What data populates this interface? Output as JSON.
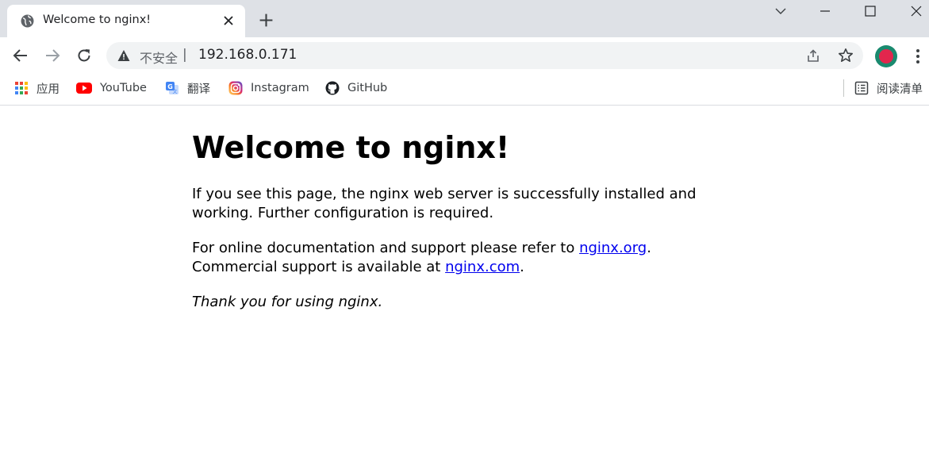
{
  "browser": {
    "tab": {
      "title": "Welcome to nginx!"
    },
    "omnibox": {
      "security_label": "不安全",
      "separator": "|",
      "url": "192.168.0.171"
    },
    "bookmarks": [
      {
        "label": "应用",
        "icon": "apps-grid-icon"
      },
      {
        "label": "YouTube",
        "icon": "youtube-icon"
      },
      {
        "label": "翻译",
        "icon": "google-translate-icon"
      },
      {
        "label": "Instagram",
        "icon": "instagram-icon"
      },
      {
        "label": "GitHub",
        "icon": "github-icon"
      }
    ],
    "reading_list": {
      "label": "阅读清单",
      "icon": "reading-list-icon"
    },
    "colors": {
      "tabstrip": "#dee1e6",
      "omnibox": "#f1f3f4",
      "link": "#0000ee",
      "avatar_ring": "#1a8a6f",
      "avatar_fill": "#e2264d"
    }
  },
  "page": {
    "heading": "Welcome to nginx!",
    "para1": "If you see this page, the nginx web server is successfully installed and working. Further configuration is required.",
    "para2_prefix": "For online documentation and support please refer to ",
    "link1": "nginx.org",
    "para2_mid": ".",
    "para2_line2_prefix": "Commercial support is available at ",
    "link2": "nginx.com",
    "para2_suffix": ".",
    "thanks": "Thank you for using nginx."
  }
}
